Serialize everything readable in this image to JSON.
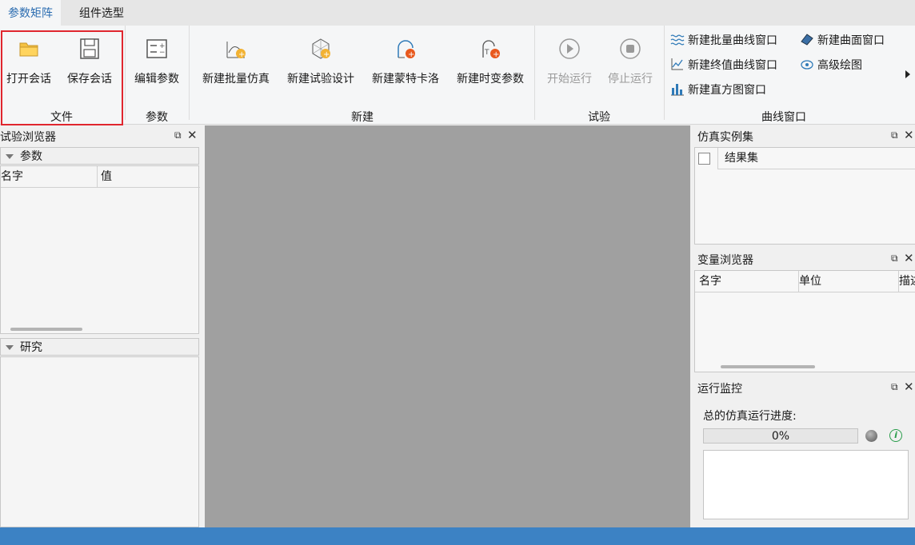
{
  "tabs": [
    {
      "label": "参数矩阵",
      "active": true
    },
    {
      "label": "组件选型",
      "active": false
    }
  ],
  "ribbon": {
    "groups": {
      "file": "文件",
      "params": "参数",
      "new": "新建",
      "experiment": "试验",
      "curve": "曲线窗口"
    },
    "buttons": {
      "open_session": "打开会话",
      "save_session": "保存会话",
      "edit_params": "编辑参数",
      "new_batch_sim": "新建批量仿真",
      "new_test_design": "新建试验设计",
      "new_monte_carlo": "新建蒙特卡洛",
      "new_time_varying": "新建时变参数",
      "start_run": "开始运行",
      "stop_run": "停止运行",
      "new_batch_curve": "新建批量曲线窗口",
      "new_surface": "新建曲面窗口",
      "new_final_curve": "新建终值曲线窗口",
      "advanced_plot": "高级绘图",
      "new_histogram": "新建直方图窗口"
    },
    "highlight_color": "#e0262e"
  },
  "left": {
    "title": "试验浏览器",
    "params_section": "参数",
    "columns": [
      "名字",
      "值"
    ],
    "study_section": "研究"
  },
  "right": {
    "sim_instances": {
      "title": "仿真实例集",
      "column": "结果集"
    },
    "var_browser": {
      "title": "变量浏览器",
      "columns": [
        "名字",
        "单位",
        "描述"
      ]
    },
    "run_monitor": {
      "title": "运行监控",
      "progress_label": "总的仿真运行进度:",
      "progress_value": "0%",
      "progress_fraction": 0
    }
  },
  "colors": {
    "workspace": "#a0a0a0",
    "statusbar": "#3c82c4",
    "accent": "#2b6cb0"
  }
}
